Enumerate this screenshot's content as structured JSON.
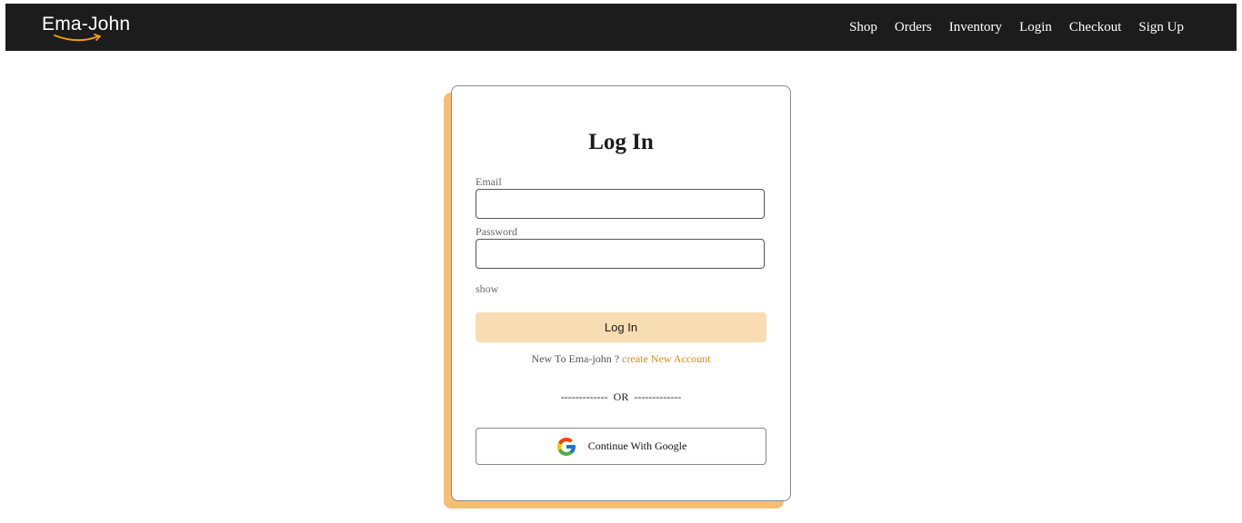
{
  "header": {
    "brand": "Ema-John",
    "nav": [
      "Shop",
      "Orders",
      "Inventory",
      "Login",
      "Checkout",
      "Sign Up"
    ]
  },
  "login": {
    "title": "Log In",
    "email_label": "Email",
    "email_value": "",
    "password_label": "Password",
    "password_value": "",
    "show_label": "show",
    "submit_label": "Log In",
    "new_prompt": "New To Ema-john ?",
    "create_link": "create New Account",
    "or_text": "-------------  OR  -------------",
    "google_label": "Continue With Google"
  },
  "colors": {
    "header_bg": "#1c1c1c",
    "accent": "#f6bd75",
    "button_bg": "#f8dcb2",
    "link": "#e08a1e"
  },
  "icons": {
    "brand_smile": "amazon-smile-icon",
    "google": "google-g-icon"
  }
}
